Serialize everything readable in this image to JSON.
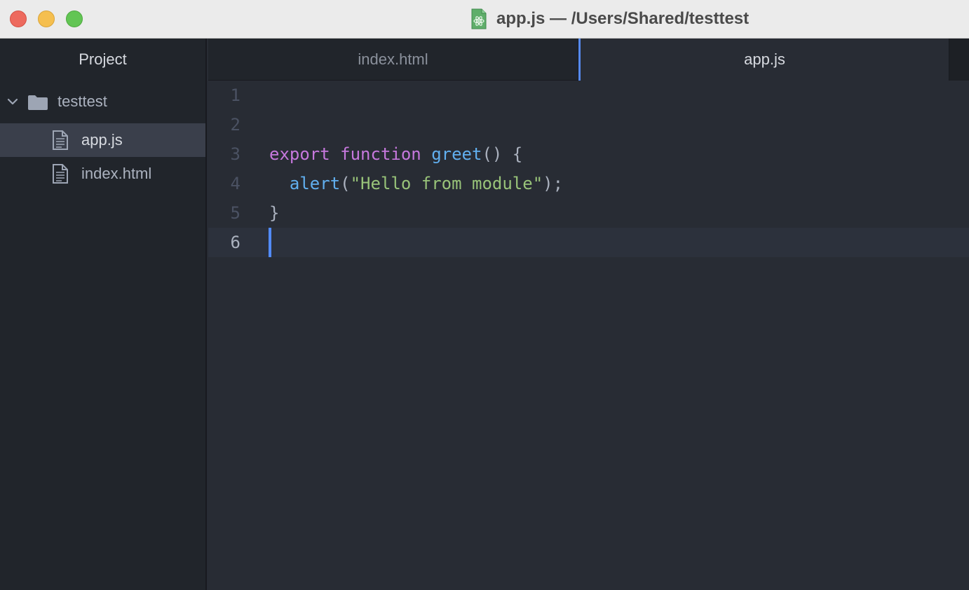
{
  "window": {
    "title": "app.js — /Users/Shared/testtest",
    "title_icon": "atom-file-icon"
  },
  "sidebar": {
    "header": "Project",
    "root": {
      "label": "testtest",
      "expanded": true
    },
    "files": [
      {
        "label": "app.js",
        "selected": true
      },
      {
        "label": "index.html",
        "selected": false
      }
    ]
  },
  "tabs": [
    {
      "label": "index.html",
      "active": false
    },
    {
      "label": "app.js",
      "active": true
    }
  ],
  "editor": {
    "line_numbers": [
      "1",
      "2",
      "3",
      "4",
      "5",
      "6"
    ],
    "lines": [
      {
        "tokens": []
      },
      {
        "tokens": []
      },
      {
        "tokens": [
          {
            "text": "export",
            "kind": "keyword"
          },
          {
            "text": " ",
            "kind": "plain"
          },
          {
            "text": "function",
            "kind": "keyword"
          },
          {
            "text": " ",
            "kind": "plain"
          },
          {
            "text": "greet",
            "kind": "function"
          },
          {
            "text": "() {",
            "kind": "plain"
          }
        ]
      },
      {
        "tokens": [
          {
            "text": "  ",
            "kind": "plain"
          },
          {
            "text": "alert",
            "kind": "function"
          },
          {
            "text": "(",
            "kind": "plain"
          },
          {
            "text": "\"Hello from module\"",
            "kind": "string"
          },
          {
            "text": ");",
            "kind": "plain"
          }
        ]
      },
      {
        "tokens": [
          {
            "text": "}",
            "kind": "plain"
          }
        ]
      },
      {
        "tokens": []
      }
    ],
    "cursor_line": 6
  },
  "colors": {
    "accent": "#568af2",
    "keyword": "#c678dd",
    "function": "#61afef",
    "string": "#98c379",
    "plain": "#abb2bf",
    "background": "#282c34",
    "sidebar_background": "#21252b"
  }
}
